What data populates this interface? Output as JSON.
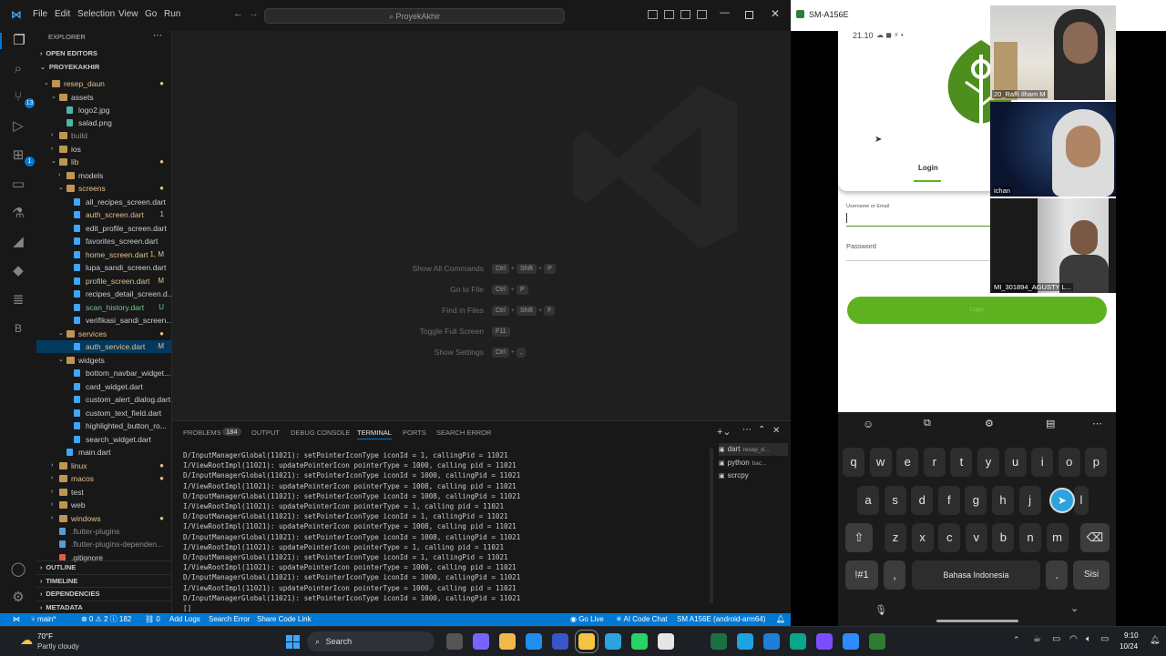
{
  "vscode": {
    "menu": [
      "File",
      "Edit",
      "Selection",
      "View",
      "Go",
      "Run"
    ],
    "search_text": "ProyekAkhir",
    "explorer_title": "EXPLORER",
    "open_editors": "OPEN EDITORS",
    "project": "PROYEKAKHIR",
    "tree": [
      {
        "label": "resep_daun",
        "depth": 0,
        "type": "folder",
        "open": true,
        "color": "#e2c08d",
        "dec": "●",
        "dec_color": "#e2c08d"
      },
      {
        "label": "assets",
        "depth": 1,
        "type": "folder",
        "open": true,
        "color": "#cccccc",
        "dec": "",
        "dec_color": ""
      },
      {
        "label": "logo2.jpg",
        "depth": 2,
        "type": "image",
        "open": false,
        "color": "#cccccc",
        "dec": "",
        "dec_color": ""
      },
      {
        "label": "salad.png",
        "depth": 2,
        "type": "image",
        "open": false,
        "color": "#cccccc",
        "dec": "",
        "dec_color": ""
      },
      {
        "label": "build",
        "depth": 1,
        "type": "folder",
        "open": false,
        "color": "#8c8c8c",
        "dec": "",
        "dec_color": ""
      },
      {
        "label": "ios",
        "depth": 1,
        "type": "folder",
        "open": false,
        "color": "#cccccc",
        "dec": "",
        "dec_color": ""
      },
      {
        "label": "lib",
        "depth": 1,
        "type": "folder",
        "open": true,
        "color": "#e2c08d",
        "dec": "●",
        "dec_color": "#e2c08d"
      },
      {
        "label": "models",
        "depth": 2,
        "type": "folder",
        "open": false,
        "color": "#cccccc",
        "dec": "",
        "dec_color": ""
      },
      {
        "label": "screens",
        "depth": 2,
        "type": "folder",
        "open": true,
        "color": "#e2c08d",
        "dec": "●",
        "dec_color": "#e2c08d"
      },
      {
        "label": "all_recipes_screen.dart",
        "depth": 3,
        "type": "dart",
        "open": false,
        "color": "#cccccc",
        "dec": "",
        "dec_color": ""
      },
      {
        "label": "auth_screen.dart",
        "depth": 3,
        "type": "dart",
        "open": false,
        "color": "#e2c08d",
        "dec": "1",
        "dec_color": "#e2c08d"
      },
      {
        "label": "edit_profile_screen.dart",
        "depth": 3,
        "type": "dart",
        "open": false,
        "color": "#cccccc",
        "dec": "",
        "dec_color": ""
      },
      {
        "label": "favorites_screen.dart",
        "depth": 3,
        "type": "dart",
        "open": false,
        "color": "#cccccc",
        "dec": "",
        "dec_color": ""
      },
      {
        "label": "home_screen.dart",
        "depth": 3,
        "type": "dart",
        "open": false,
        "color": "#e2c08d",
        "dec": "1, M",
        "dec_color": "#e2c08d"
      },
      {
        "label": "lupa_sandi_screen.dart",
        "depth": 3,
        "type": "dart",
        "open": false,
        "color": "#cccccc",
        "dec": "",
        "dec_color": ""
      },
      {
        "label": "profile_screen.dart",
        "depth": 3,
        "type": "dart",
        "open": false,
        "color": "#e2c08d",
        "dec": "M",
        "dec_color": "#e2c08d"
      },
      {
        "label": "recipes_detail_screen.d...",
        "depth": 3,
        "type": "dart",
        "open": false,
        "color": "#cccccc",
        "dec": "",
        "dec_color": ""
      },
      {
        "label": "scan_history.dart",
        "depth": 3,
        "type": "dart",
        "open": false,
        "color": "#73c991",
        "dec": "U",
        "dec_color": "#73c991"
      },
      {
        "label": "verifikasi_sandi_screen....",
        "depth": 3,
        "type": "dart",
        "open": false,
        "color": "#cccccc",
        "dec": "",
        "dec_color": ""
      },
      {
        "label": "services",
        "depth": 2,
        "type": "folder",
        "open": true,
        "color": "#e2c08d",
        "dec": "●",
        "dec_color": "#e2c08d"
      },
      {
        "label": "auth_service.dart",
        "depth": 3,
        "type": "dart",
        "open": false,
        "color": "#e2c08d",
        "dec": "M",
        "dec_color": "#e2c08d",
        "selected": true
      },
      {
        "label": "widgets",
        "depth": 2,
        "type": "folder",
        "open": true,
        "color": "#cccccc",
        "dec": "",
        "dec_color": ""
      },
      {
        "label": "bottom_navbar_widget....",
        "depth": 3,
        "type": "dart",
        "open": false,
        "color": "#cccccc",
        "dec": "",
        "dec_color": ""
      },
      {
        "label": "card_widget.dart",
        "depth": 3,
        "type": "dart",
        "open": false,
        "color": "#cccccc",
        "dec": "",
        "dec_color": ""
      },
      {
        "label": "custom_alert_dialog.dart",
        "depth": 3,
        "type": "dart",
        "open": false,
        "color": "#cccccc",
        "dec": "",
        "dec_color": ""
      },
      {
        "label": "custom_text_field.dart",
        "depth": 3,
        "type": "dart",
        "open": false,
        "color": "#cccccc",
        "dec": "",
        "dec_color": ""
      },
      {
        "label": "highlighted_button_ro...",
        "depth": 3,
        "type": "dart",
        "open": false,
        "color": "#cccccc",
        "dec": "",
        "dec_color": ""
      },
      {
        "label": "search_widget.dart",
        "depth": 3,
        "type": "dart",
        "open": false,
        "color": "#cccccc",
        "dec": "",
        "dec_color": ""
      },
      {
        "label": "main.dart",
        "depth": 2,
        "type": "dart",
        "open": false,
        "color": "#cccccc",
        "dec": "",
        "dec_color": ""
      },
      {
        "label": "linux",
        "depth": 1,
        "type": "folder",
        "open": false,
        "color": "#e2c08d",
        "dec": "●",
        "dec_color": "#e2c08d"
      },
      {
        "label": "macos",
        "depth": 1,
        "type": "folder",
        "open": false,
        "color": "#e2c08d",
        "dec": "●",
        "dec_color": "#e2c08d"
      },
      {
        "label": "test",
        "depth": 1,
        "type": "folder",
        "open": false,
        "color": "#cccccc",
        "dec": "",
        "dec_color": ""
      },
      {
        "label": "web",
        "depth": 1,
        "type": "folder",
        "open": false,
        "color": "#cccccc",
        "dec": "",
        "dec_color": ""
      },
      {
        "label": "windows",
        "depth": 1,
        "type": "folder",
        "open": false,
        "color": "#e2c08d",
        "dec": "●",
        "dec_color": "#e2c08d"
      },
      {
        "label": ".flutter-plugins",
        "depth": 1,
        "type": "file",
        "open": false,
        "color": "#8c8c8c",
        "dec": "",
        "dec_color": ""
      },
      {
        "label": ".flutter-plugins-dependen...",
        "depth": 1,
        "type": "file",
        "open": false,
        "color": "#8c8c8c",
        "dec": "",
        "dec_color": ""
      },
      {
        "label": ".gitignore",
        "depth": 1,
        "type": "git",
        "open": false,
        "color": "#cccccc",
        "dec": "",
        "dec_color": ""
      }
    ],
    "bottom_sections": [
      "OUTLINE",
      "TIMELINE",
      "DEPENDENCIES",
      "METADATA"
    ],
    "shortcuts": [
      {
        "label": "Show All Commands",
        "keys": [
          "Ctrl",
          "+",
          "Shift",
          "+",
          "P"
        ]
      },
      {
        "label": "Go to File",
        "keys": [
          "Ctrl",
          "+",
          "P"
        ]
      },
      {
        "label": "Find in Files",
        "keys": [
          "Ctrl",
          "+",
          "Shift",
          "+",
          "F"
        ]
      },
      {
        "label": "Toggle Full Screen",
        "keys": [
          "F11"
        ]
      },
      {
        "label": "Show Settings",
        "keys": [
          "Ctrl",
          "+",
          ","
        ]
      }
    ],
    "panel_tabs": [
      "PROBLEMS",
      "184",
      "OUTPUT",
      "DEBUG CONSOLE",
      "TERMINAL",
      "PORTS",
      "SEARCH ERROR"
    ],
    "terminal_lines": [
      "D/InputManagerGlobal(11021): setPointerIconType iconId = 1, callingPid = 11021",
      "I/ViewRootImpl(11021): updatePointerIcon pointerType = 1000, calling pid = 11021",
      "D/InputManagerGlobal(11021): setPointerIconType iconId = 1000, callingPid = 11021",
      "I/ViewRootImpl(11021): updatePointerIcon pointerType = 1008, calling pid = 11021",
      "D/InputManagerGlobal(11021): setPointerIconType iconId = 1008, callingPid = 11021",
      "I/ViewRootImpl(11021): updatePointerIcon pointerType = 1, calling pid = 11021",
      "D/InputManagerGlobal(11021): setPointerIconType iconId = 1, callingPid = 11021",
      "I/ViewRootImpl(11021): updatePointerIcon pointerType = 1008, calling pid = 11021",
      "D/InputManagerGlobal(11021): setPointerIconType iconId = 1008, callingPid = 11021",
      "I/ViewRootImpl(11021): updatePointerIcon pointerType = 1, calling pid = 11021",
      "D/InputManagerGlobal(11021): setPointerIconType iconId = 1, callingPid = 11021",
      "I/ViewRootImpl(11021): updatePointerIcon pointerType = 1000, calling pid = 11021",
      "D/InputManagerGlobal(11021): setPointerIconType iconId = 1000, callingPid = 11021",
      "I/ViewRootImpl(11021): updatePointerIcon pointerType = 1000, calling pid = 11021",
      "D/InputManagerGlobal(11021): setPointerIconType iconId = 1000, callingPid = 11021",
      "[]"
    ],
    "terminal_list": [
      {
        "name": "dart",
        "sub": "resep_d..."
      },
      {
        "name": "python",
        "sub": "bac..."
      },
      {
        "name": "scrcpy",
        "sub": ""
      }
    ],
    "status": {
      "branch": "main*",
      "errors": "⊗ 0 ⚠ 2 ⓘ 182",
      "ports": "⛓ 0",
      "add_logs": "Add Logs",
      "search_error": "Search Error",
      "share": "Share Code Link",
      "golive": "◉ Go Live",
      "ai": "✳ AI Code Chat",
      "device": "SM A156E (android-arm64)"
    }
  },
  "scrcpy": {
    "title": "SM-A156E",
    "phone_time": "21.10",
    "tab_login": "Login",
    "username_label": "Username or Email",
    "password_label": "Password",
    "login_button": "Login",
    "keyboard": {
      "row1": [
        "q",
        "w",
        "e",
        "r",
        "t",
        "y",
        "u",
        "i",
        "o",
        "p"
      ],
      "row2": [
        "a",
        "s",
        "d",
        "f",
        "g",
        "h",
        "j",
        "l"
      ],
      "row3": [
        "z",
        "x",
        "c",
        "v",
        "b",
        "n",
        "m"
      ],
      "sym": "!#1",
      "comma": ",",
      "space": "Bahasa Indonesia",
      "period": ".",
      "enter": "Sisi"
    },
    "accent": "#5fb21f"
  },
  "meeting": {
    "tiles": [
      "20_Raffi Ilham M",
      "ichan",
      "MI_301894_AGUSTY L..."
    ]
  },
  "taskbar": {
    "weather_temp": "70°F",
    "weather_desc": "Partly cloudy",
    "search": "Search",
    "time": "9:10",
    "date": "10/24"
  }
}
